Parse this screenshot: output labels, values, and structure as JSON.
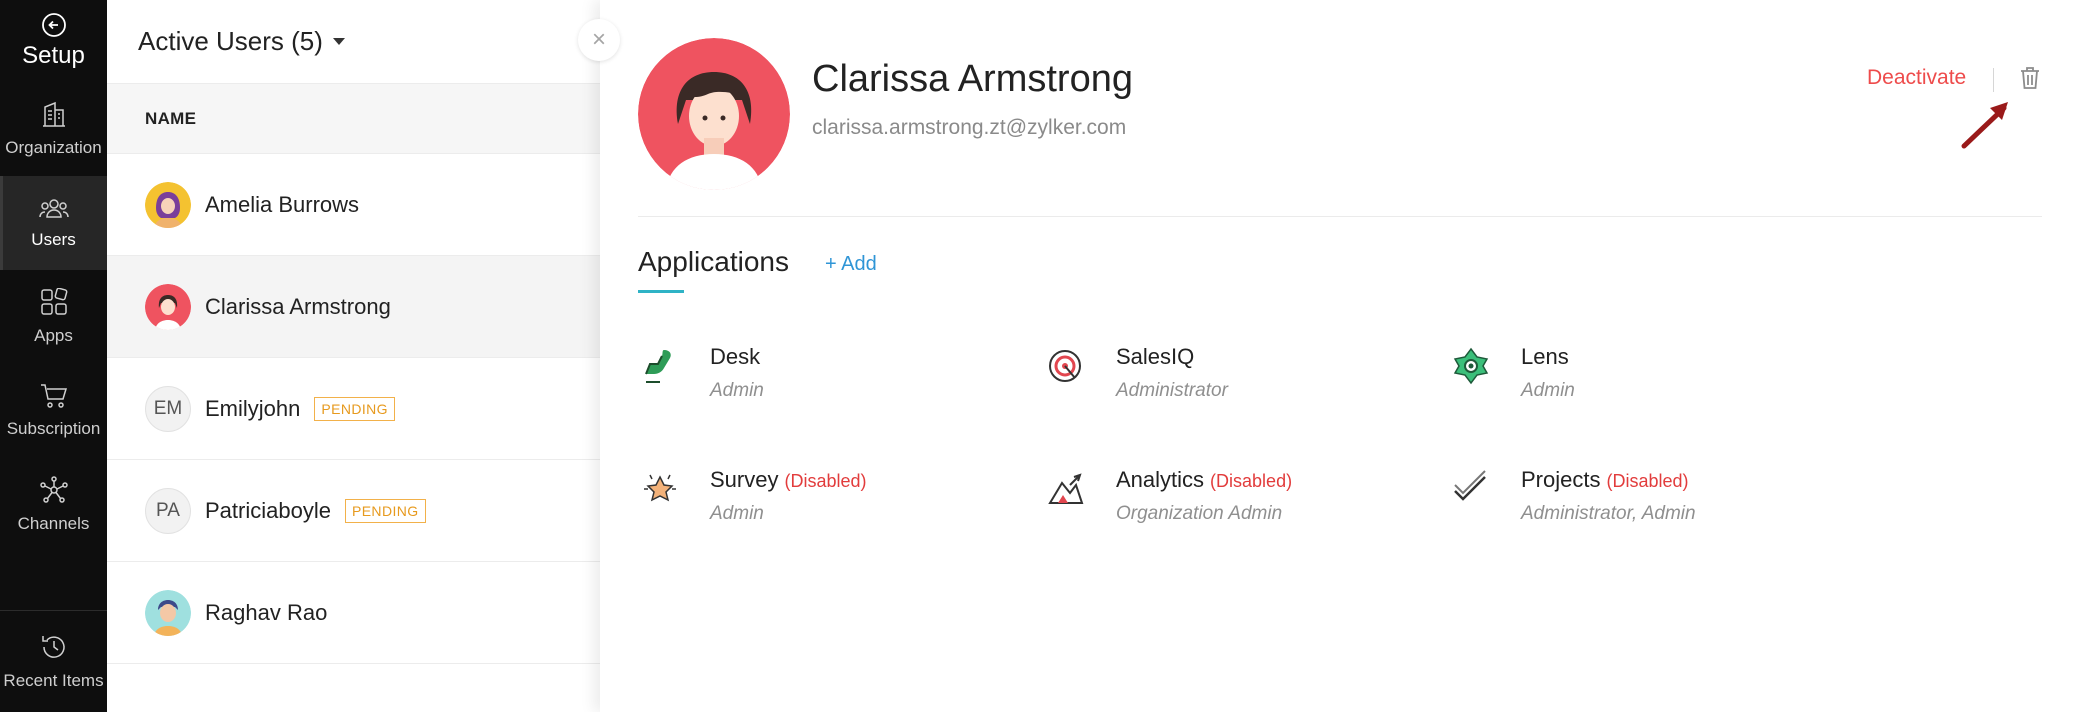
{
  "nav": {
    "setup_label": "Setup",
    "items": [
      {
        "label": "Organization",
        "icon": "building-icon"
      },
      {
        "label": "Users",
        "icon": "users-icon"
      },
      {
        "label": "Apps",
        "icon": "apps-icon"
      },
      {
        "label": "Subscription",
        "icon": "cart-icon"
      },
      {
        "label": "Channels",
        "icon": "channels-icon"
      }
    ],
    "recent_label": "Recent Items"
  },
  "list": {
    "title": "Active Users (5)",
    "column_name": "NAME",
    "rows": [
      {
        "name": "Amelia Burrows"
      },
      {
        "name": "Clarissa Armstrong"
      },
      {
        "initials": "EM",
        "name": "Emilyjohn",
        "badge": "PENDING"
      },
      {
        "initials": "PA",
        "name": "Patriciaboyle",
        "badge": "PENDING"
      },
      {
        "name": "Raghav Rao"
      }
    ]
  },
  "detail": {
    "close_glyph": "×",
    "name": "Clarissa Armstrong",
    "email": "clarissa.armstrong.zt@zylker.com",
    "deactivate": "Deactivate",
    "tab": "Applications",
    "add": "+ Add",
    "apps": [
      {
        "name": "Desk",
        "role": "Admin",
        "status": ""
      },
      {
        "name": "SalesIQ",
        "role": "Administrator",
        "status": ""
      },
      {
        "name": "Lens",
        "role": "Admin",
        "status": ""
      },
      {
        "name": "Survey",
        "role": "Admin",
        "status": "(Disabled)"
      },
      {
        "name": "Analytics",
        "role": "Organization Admin",
        "status": "(Disabled)"
      },
      {
        "name": "Projects",
        "role": "Administrator, Admin",
        "status": "(Disabled)"
      }
    ]
  },
  "colors": {
    "accent_red": "#ee4b4b",
    "link_blue": "#2f95d6",
    "tab_underline": "#2fb3c6",
    "pending_orange": "#e79a1e",
    "nav_bg": "#0e0e0e"
  }
}
